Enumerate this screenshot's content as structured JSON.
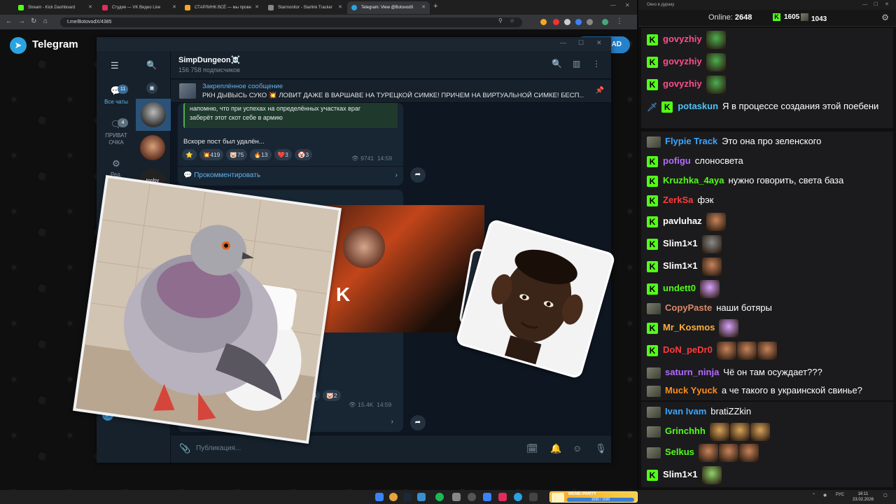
{
  "browser": {
    "tabs": [
      {
        "title": "Stream - Kick Dashboard",
        "color": "#53fc18",
        "active": false
      },
      {
        "title": "Студия — VK Видео Live",
        "color": "#e52a5c",
        "active": false
      },
      {
        "title": "СТАРЛИНК ВСЁ — мы прове",
        "color": "#f5a623",
        "active": false
      },
      {
        "title": "Starmonitor - Starlink Tracker",
        "color": "#888888",
        "active": false
      },
      {
        "title": "Telegram: View @BotovodX",
        "color": "#2aa3e0",
        "active": true
      }
    ],
    "url": "t.me/BotovodX/4385"
  },
  "tgweb": {
    "title": "Telegram",
    "open_button": "AD"
  },
  "tg": {
    "chat_name": "SimpDungeon☠️",
    "subscribers": "156 758 подписчиков",
    "folders": [
      {
        "label": "Все чаты",
        "badge": "11",
        "active": true
      },
      {
        "label": "ПРИВАТ ОЧКА",
        "badge": "4",
        "active": false
      },
      {
        "label": "Ред.",
        "badge": "",
        "active": false
      }
    ],
    "pinned": {
      "title": "Закреплённое сообщение",
      "text": "РКН ДЫВЫСЬ СУКО 💥 ЛОВИТ ДАЖЕ В ВАРШАВЕ НА ТУРЕЦКОЙ СИМКЕ! ПРИЧЕМ НА ВИРТУАЛЬНОЙ СИМКЕ! БЕСП..."
    },
    "post1": {
      "quote_line1": "напомню, что при успехах на определённых участках враг",
      "quote_line2": "заберёт этот скот себе в армию",
      "text": "Вскоре пост был удалён...",
      "reactions": [
        {
          "emoji": "⭐",
          "count": ""
        },
        {
          "emoji": "💥",
          "count": "419"
        },
        {
          "emoji": "🐷",
          "count": "75"
        },
        {
          "emoji": "🔥",
          "count": "13"
        },
        {
          "emoji": "❤️",
          "count": "3"
        },
        {
          "emoji": "🤡",
          "count": "3"
        }
      ],
      "views": "9741",
      "time": "14:59",
      "comment": "Прокомментировать"
    },
    "post2": {
      "banner_text": "N K",
      "reactions": [
        {
          "emoji": "❤️",
          "count": "4"
        },
        {
          "emoji": "🐷",
          "count": "2"
        }
      ],
      "views": "15.4K",
      "time": "14:59"
    },
    "compose_placeholder": "Публикация..."
  },
  "rpanel": {
    "window_title": "Окно в дураку",
    "online_label": "Online:",
    "online_count": "2648",
    "kick_count": "1605",
    "other_count": "1043",
    "messages": [
      {
        "badge": "kick",
        "nick": "govyzhiy",
        "color": "#ff4d8a",
        "text": "",
        "emotes": [
          "#4caf50"
        ]
      },
      {
        "badge": "kick",
        "nick": "govyzhiy",
        "color": "#ff4d8a",
        "text": "",
        "emotes": [
          "#4caf50"
        ]
      },
      {
        "badge": "kick",
        "nick": "govyzhiy",
        "color": "#ff4d8a",
        "text": "",
        "emotes": [
          "#4caf50"
        ]
      },
      {
        "badge": "sword",
        "nick": "potaskun",
        "color": "#4fc3f7",
        "text": "Я в процессе создания этой поебени",
        "emotes": []
      },
      {
        "badge": "avatar",
        "nick": "Flypie Track",
        "color": "#3da5ff",
        "text": "Это она про зеленского",
        "emotes": []
      },
      {
        "badge": "kick",
        "nick": "pofigu",
        "color": "#b36bff",
        "text": "слоносвета",
        "emotes": []
      },
      {
        "badge": "kick",
        "nick": "Kruzhka_4aya",
        "color": "#53fc18",
        "text": "нужно говорить, света база",
        "emotes": []
      },
      {
        "badge": "kick",
        "nick": "ZerkSa",
        "color": "#ff3b3b",
        "text": "фэк",
        "emotes": []
      },
      {
        "badge": "kick",
        "nick": "pavluhaz",
        "color": "#ffffff",
        "text": "",
        "emotes": [
          "#c8845a"
        ]
      },
      {
        "badge": "kick",
        "nick": "Slim1×1",
        "color": "#ffffff",
        "text": "",
        "emotes": [
          "#8a8a8a"
        ]
      },
      {
        "badge": "kick",
        "nick": "Slim1×1",
        "color": "#ffffff",
        "text": "",
        "emotes": [
          "#c8845a"
        ]
      },
      {
        "badge": "kick",
        "nick": "undett0",
        "color": "#53fc18",
        "text": "",
        "emotes": [
          "#d9a3ff"
        ]
      },
      {
        "badge": "avatar",
        "nick": "CopyPaste",
        "color": "#d98a6b",
        "text": "наши ботяры",
        "emotes": []
      },
      {
        "badge": "kick",
        "nick": "Mr_Kosmos",
        "color": "#ffb03b",
        "text": "",
        "emotes": [
          "#d9a3ff"
        ]
      },
      {
        "badge": "kick",
        "nick": "DoN_peDr0",
        "color": "#ff3b3b",
        "text": "",
        "emotes": [
          "#c8845a",
          "#c8845a",
          "#c8845a"
        ]
      },
      {
        "badge": "avatar",
        "nick": "saturn_ninja",
        "color": "#b36bff",
        "text": "Чё он там осуждает???",
        "emotes": []
      },
      {
        "badge": "avatar",
        "nick": "Muck Yyuck",
        "color": "#ff8c1a",
        "text": "а че такого в украинской свинье?",
        "emotes": []
      },
      {
        "badge": "avatar",
        "nick": "Ivan Ivam",
        "color": "#3da5ff",
        "text": "bratiZZkin",
        "emotes": []
      },
      {
        "badge": "avatar",
        "nick": "Grinchhh",
        "color": "#53fc18",
        "text": "",
        "emotes": [
          "#d9a45a",
          "#d9a45a",
          "#d9a45a"
        ]
      },
      {
        "badge": "avatar",
        "nick": "Selkus",
        "color": "#53fc18",
        "text": "",
        "emotes": [
          "#c8845a",
          "#c8845a",
          "#c8845a"
        ]
      },
      {
        "badge": "kick",
        "nick": "Slim1×1",
        "color": "#ffffff",
        "text": "",
        "emotes": [
          "#8fd46a"
        ]
      }
    ]
  },
  "taskbar": {
    "meme_title": "MEME-PARTY",
    "meme_progress": "1500 / 1500",
    "lang": "РУС",
    "time": "16:11",
    "date": "23.02.2026"
  }
}
